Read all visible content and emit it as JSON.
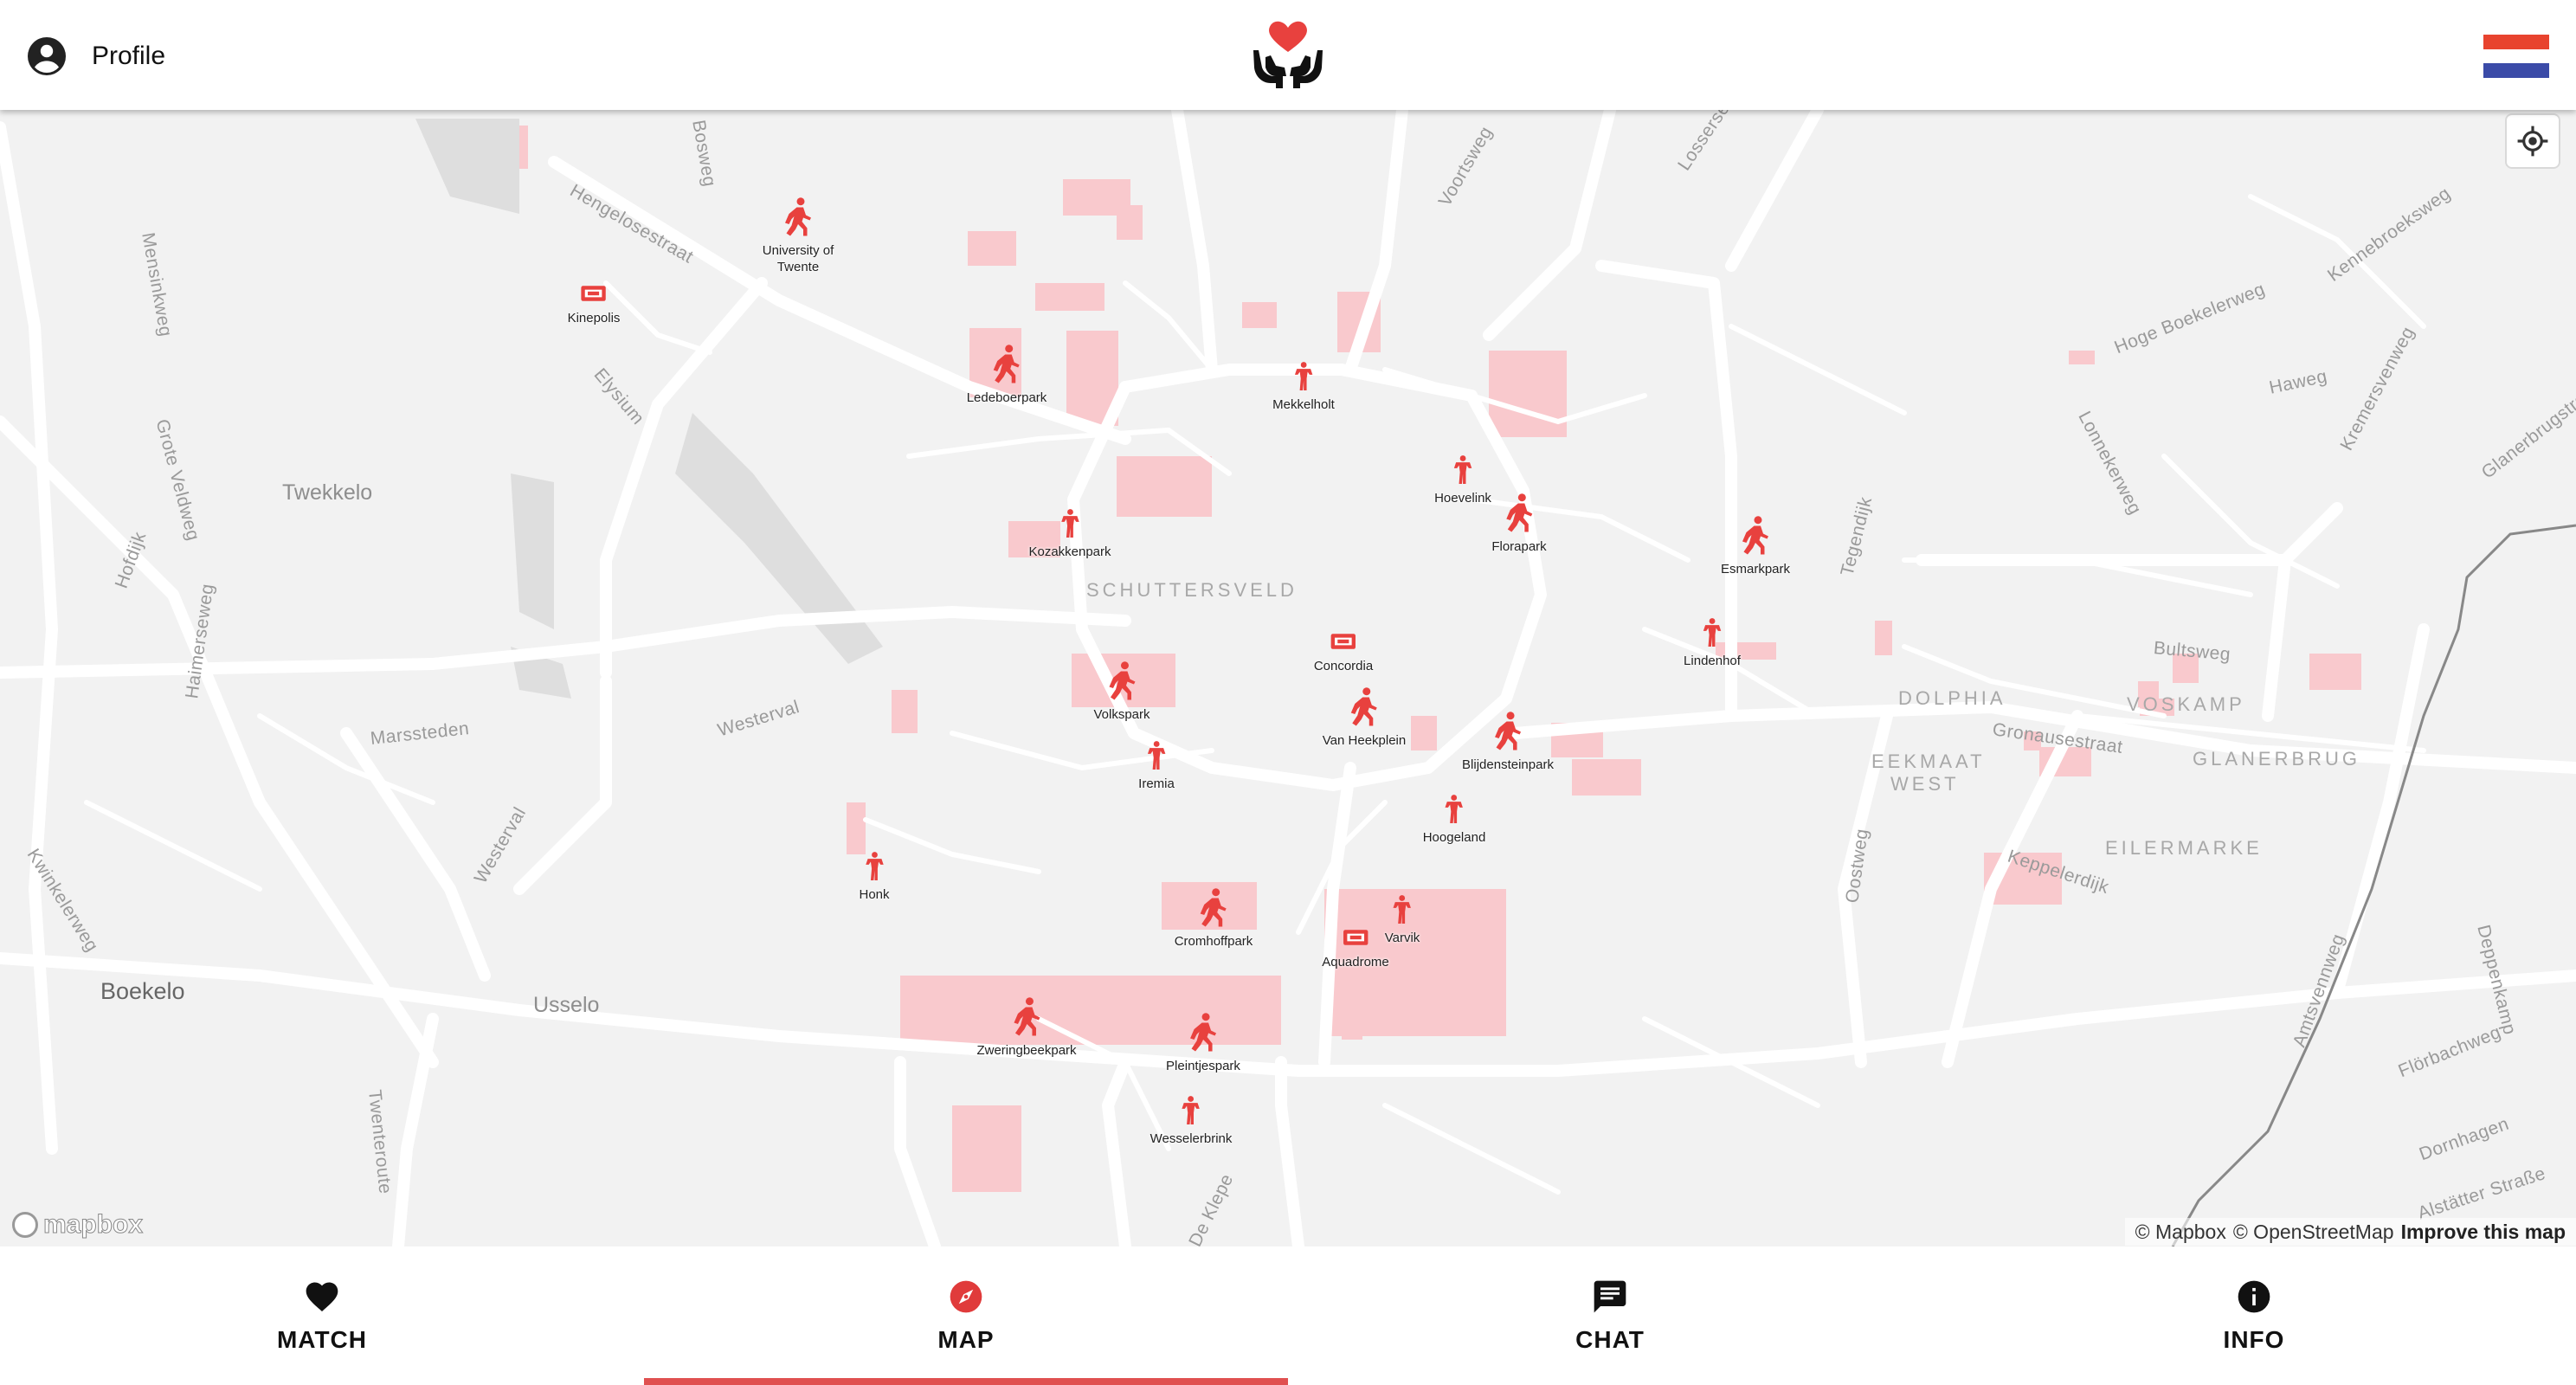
{
  "header": {
    "profile_label": "Profile",
    "logo_icon": "heart-in-hands-icon",
    "flag_icon": "netherlands-flag-icon",
    "flag_colors": [
      "#e8432e",
      "#ffffff",
      "#3b4ba8"
    ]
  },
  "map": {
    "locate_icon": "my-location-icon",
    "districts": [
      "SCHUTTERSVELD",
      "DOLPHIA",
      "VOSKAMP",
      "GLANERBRUG",
      "EEKMAAT",
      "WEST",
      "EILERMARKE"
    ],
    "towns": [
      "Twekkelo",
      "Boekelo",
      "Usselo"
    ],
    "streets": [
      "Hengelosestraat",
      "Elysium",
      "Mensinkweg",
      "Grote Veldweg",
      "Hofdijk",
      "Haimerseweg",
      "Marssteden",
      "Westerval",
      "Westerval",
      "Kwinkelerweg",
      "Twenteroute",
      "De Klepe",
      "Voortsweg",
      "Lossersestraat",
      "Kennebroeksweg",
      "Hoge Boekelerweg",
      "Haweg",
      "Kremersvenweg",
      "Glanerbrugstraat",
      "Lonnekerweg",
      "Tegendijk",
      "Bultsweg",
      "Gronausestraat",
      "Keppelerdijk",
      "Oostweg",
      "Amtsvennweg",
      "Deppenkamp",
      "Flörbachweg",
      "Dornhagen",
      "Alstätter Straße",
      "Bosweg"
    ],
    "markers": [
      {
        "label": "University of Twente",
        "type": "park"
      },
      {
        "label": "Kinepolis",
        "type": "cinema"
      },
      {
        "label": "Ledeboerpark",
        "type": "park"
      },
      {
        "label": "Mekkelholt",
        "type": "playground"
      },
      {
        "label": "Kozakkenpark",
        "type": "playground"
      },
      {
        "label": "Hoevelink",
        "type": "playground"
      },
      {
        "label": "Florapark",
        "type": "park"
      },
      {
        "label": "Esmarkpark",
        "type": "park"
      },
      {
        "label": "Lindenhof",
        "type": "playground"
      },
      {
        "label": "Concordia",
        "type": "cinema"
      },
      {
        "label": "Volkspark",
        "type": "park"
      },
      {
        "label": "Van Heekplein",
        "type": "park"
      },
      {
        "label": "Blijdensteinpark",
        "type": "park"
      },
      {
        "label": "Iremia",
        "type": "playground"
      },
      {
        "label": "Hoogeland",
        "type": "playground"
      },
      {
        "label": "Honk",
        "type": "playground"
      },
      {
        "label": "Cromhoffpark",
        "type": "park"
      },
      {
        "label": "Varvik",
        "type": "playground"
      },
      {
        "label": "Aquadrome",
        "type": "cinema"
      },
      {
        "label": "Zweringbeekpark",
        "type": "park"
      },
      {
        "label": "Pleintjespark",
        "type": "park"
      },
      {
        "label": "Wesselerbrink",
        "type": "playground"
      }
    ],
    "mapbox_logo": "mapbox",
    "attribution": {
      "mapbox": "© Mapbox",
      "osm": "© OpenStreetMap",
      "improve": "Improve this map"
    }
  },
  "nav": {
    "tabs": [
      {
        "label": "MATCH",
        "icon": "heart-icon",
        "active": false
      },
      {
        "label": "MAP",
        "icon": "compass-icon",
        "active": true
      },
      {
        "label": "CHAT",
        "icon": "chat-icon",
        "active": false
      },
      {
        "label": "INFO",
        "icon": "info-icon",
        "active": false
      }
    ],
    "accent_color": "#e05050"
  }
}
